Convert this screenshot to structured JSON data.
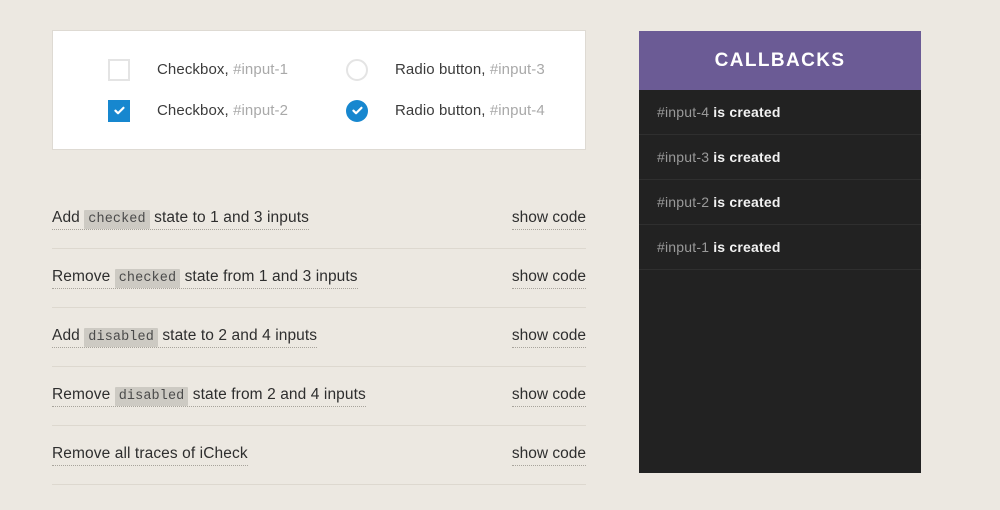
{
  "colors": {
    "page_background": "#ece8e1",
    "accent_blue": "#1787cf",
    "panel_purple": "#6b5b95",
    "panel_dark": "#222222",
    "code_token_background": "#cdcac3"
  },
  "inputs_card": {
    "items": [
      {
        "type": "checkbox",
        "checked": false,
        "label": "Checkbox,",
        "target": "#input-1",
        "icon": "empty-checkbox-icon"
      },
      {
        "type": "radio",
        "checked": false,
        "label": "Radio button,",
        "target": "#input-3",
        "icon": "empty-radio-icon"
      },
      {
        "type": "checkbox",
        "checked": true,
        "label": "Checkbox,",
        "target": "#input-2",
        "icon": "checkmark-icon"
      },
      {
        "type": "radio",
        "checked": true,
        "label": "Radio button,",
        "target": "#input-4",
        "icon": "checkmark-icon"
      }
    ]
  },
  "actions": {
    "show_code_label": "show code",
    "rows": [
      {
        "prefix": "Add ",
        "token": "checked",
        "suffix": " state to 1 and 3 inputs"
      },
      {
        "prefix": "Remove ",
        "token": "checked",
        "suffix": " state from 1 and 3 inputs"
      },
      {
        "prefix": "Add ",
        "token": "disabled",
        "suffix": " state to 2 and 4 inputs"
      },
      {
        "prefix": "Remove ",
        "token": "disabled",
        "suffix": " state from 2 and 4 inputs"
      },
      {
        "prefix": "Remove all traces of iCheck",
        "token": "",
        "suffix": ""
      }
    ]
  },
  "callbacks": {
    "title": "CALLBACKS",
    "items": [
      {
        "target": "#input-4",
        "message": "is created"
      },
      {
        "target": "#input-3",
        "message": "is created"
      },
      {
        "target": "#input-2",
        "message": "is created"
      },
      {
        "target": "#input-1",
        "message": "is created"
      }
    ]
  }
}
